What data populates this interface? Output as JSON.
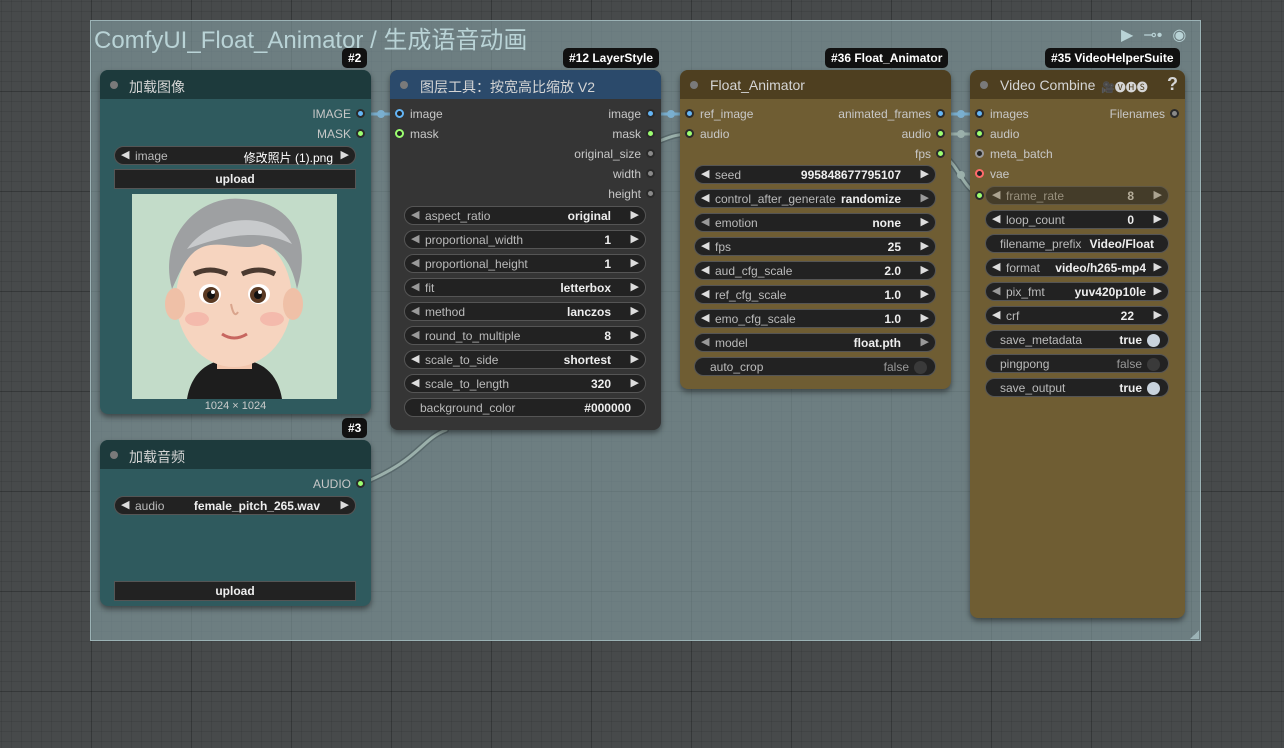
{
  "group": {
    "title": "ComfyUI_Float_Animator / 生成语音动画",
    "icons": [
      "play-icon",
      "link-icon",
      "eye-icon"
    ]
  },
  "badges": {
    "load_image": "#2",
    "layer_style": "#12 LayerStyle",
    "float": "#36 Float_Animator",
    "vhs": "#35 VideoHelperSuite",
    "load_audio": "#3"
  },
  "load_image": {
    "title": "加载图像",
    "outputs": [
      "IMAGE",
      "MASK"
    ],
    "widget_label": "image",
    "widget_value": "修改照片 (1).png",
    "upload": "upload",
    "dims": "1024 × 1024"
  },
  "load_audio": {
    "title": "加载音频",
    "output": "AUDIO",
    "widget_label": "audio",
    "widget_value": "female_pitch_265.wav",
    "upload": "upload"
  },
  "layer": {
    "title": "图层工具：按宽高比缩放 V2",
    "inputs": [
      "image",
      "mask"
    ],
    "outputs": [
      "image",
      "mask",
      "original_size",
      "width",
      "height"
    ],
    "widgets": [
      {
        "label": "aspect_ratio",
        "value": "original"
      },
      {
        "label": "proportional_width",
        "value": "1"
      },
      {
        "label": "proportional_height",
        "value": "1"
      },
      {
        "label": "fit",
        "value": "letterbox"
      },
      {
        "label": "method",
        "value": "lanczos"
      },
      {
        "label": "round_to_multiple",
        "value": "8"
      },
      {
        "label": "scale_to_side",
        "value": "shortest"
      },
      {
        "label": "scale_to_length",
        "value": "320"
      },
      {
        "label": "background_color",
        "value": "#000000"
      }
    ]
  },
  "float": {
    "title": "Float_Animator",
    "inputs": [
      "ref_image",
      "audio"
    ],
    "outputs": [
      "animated_frames",
      "audio",
      "fps"
    ],
    "widgets": [
      {
        "label": "seed",
        "value": "995848677795107"
      },
      {
        "label": "control_after_generate",
        "value": "randomize"
      },
      {
        "label": "emotion",
        "value": "none"
      },
      {
        "label": "fps",
        "value": "25"
      },
      {
        "label": "aud_cfg_scale",
        "value": "2.0"
      },
      {
        "label": "ref_cfg_scale",
        "value": "1.0"
      },
      {
        "label": "emo_cfg_scale",
        "value": "1.0"
      },
      {
        "label": "model",
        "value": "float.pth"
      },
      {
        "label": "auto_crop",
        "value": "false"
      }
    ]
  },
  "vc": {
    "title": "Video Combine",
    "title_icons": "🎥🅥🅗🅢",
    "help": "?",
    "inputs": [
      "images",
      "audio",
      "meta_batch",
      "vae"
    ],
    "output": "Filenames",
    "widgets": [
      {
        "label": "frame_rate",
        "value": "8"
      },
      {
        "label": "loop_count",
        "value": "0"
      },
      {
        "label": "filename_prefix",
        "value": "Video/Float"
      },
      {
        "label": "format",
        "value": "video/h265-mp4"
      },
      {
        "label": "pix_fmt",
        "value": "yuv420p10le"
      },
      {
        "label": "crf",
        "value": "22"
      },
      {
        "label": "save_metadata",
        "value": "true"
      },
      {
        "label": "pingpong",
        "value": "false"
      },
      {
        "label": "save_output",
        "value": "true"
      }
    ]
  },
  "colors": {
    "image": "#64b5f6",
    "mask": "#9cff70",
    "audio": "#9cff70",
    "vae": "#ff6b6b",
    "link": "#c8d0c0"
  }
}
